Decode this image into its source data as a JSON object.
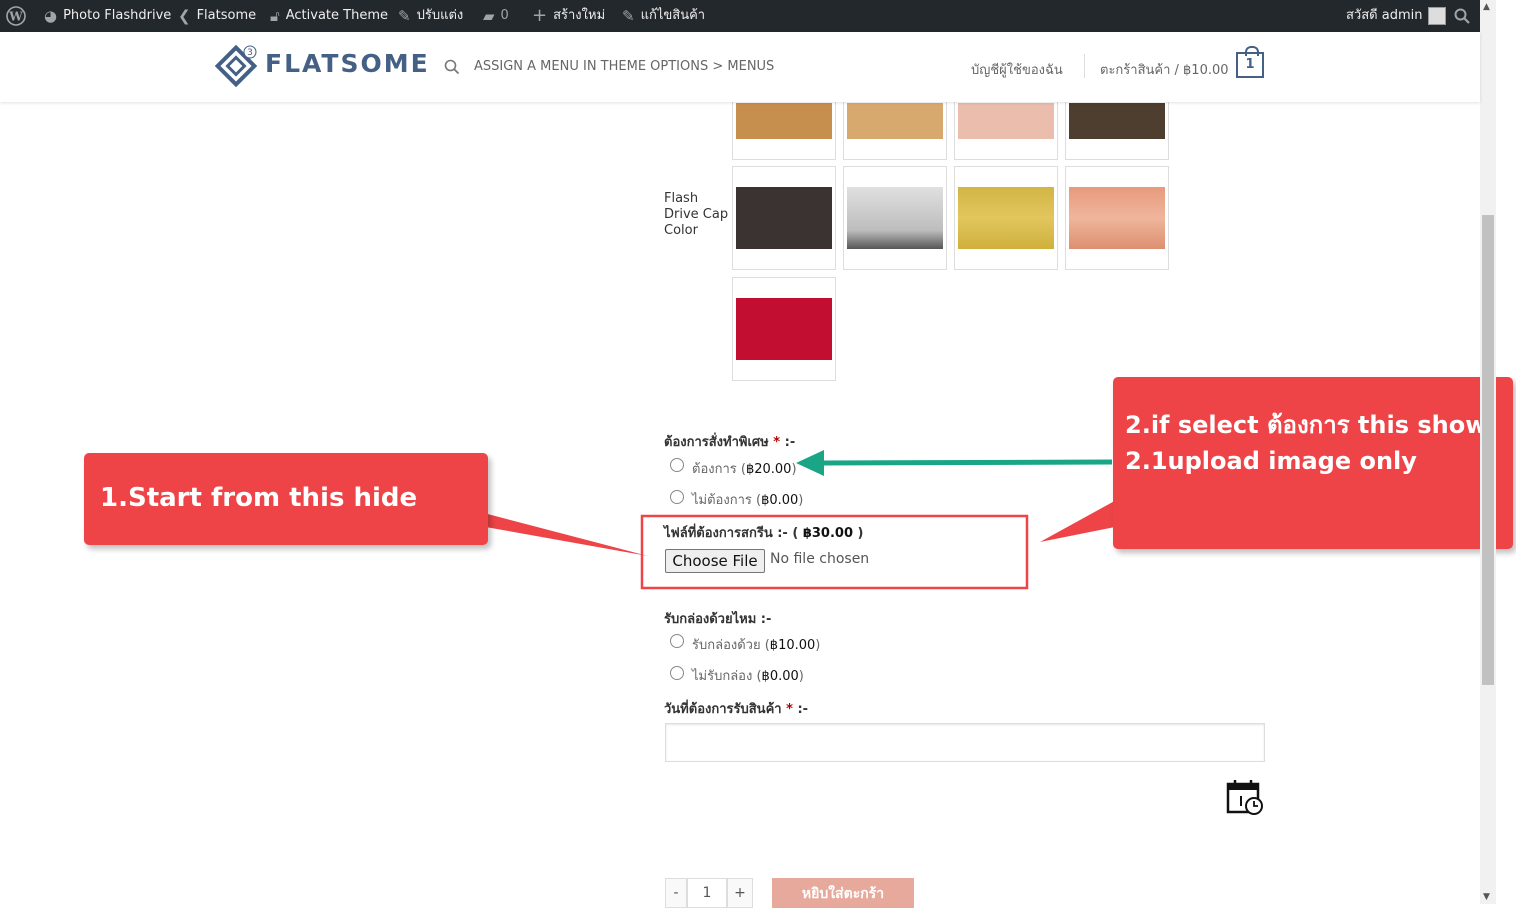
{
  "admin_bar": {
    "site_name": "Photo Flashdrive",
    "theme": "Flatsome",
    "activate": "Activate Theme",
    "customize": "ปรับแต่ง",
    "comments_count": "0",
    "new": "สร้างใหม่",
    "edit_product": "แก้ไขสินค้า",
    "greeting": "สวัสดี admin"
  },
  "header": {
    "logo_text": "FLATSOME",
    "logo_badge": "3",
    "menu_hint": "ASSIGN A MENU IN THEME OPTIONS > MENUS",
    "account": "บัญชีผู้ใช้ของฉัน",
    "cart_label": "ตะกร้าสินค้า / ฿10.00",
    "cart_count": "1"
  },
  "swatches_top": [
    "#c78f4e",
    "#d8a96f",
    "#eabdac",
    "#4e3e30"
  ],
  "cap_color": {
    "label": "Flash Drive Cap Color",
    "swatches": [
      "#3a3331",
      "#c9c9c9",
      "#d7ba47",
      "#e39f82",
      "#c20f31"
    ]
  },
  "special_order": {
    "label": "ต้องการสั่งทำพิเศษ",
    "required": "*",
    "suffix": ":-",
    "opt_yes": "ต้องการ (",
    "opt_yes_price": "฿20.00",
    "opt_no": "ไม่ต้องการ (",
    "opt_no_price": "฿0.00"
  },
  "file_upload": {
    "label": "ไฟล์ที่ต้องการสกรีน :- (",
    "price": "฿30.00",
    "button": "Choose File",
    "status": "No file chosen"
  },
  "gift_box": {
    "label": "รับกล่องด้วยไหม :-",
    "opt_yes": "รับกล่องด้วย (",
    "opt_yes_price": "฿10.00",
    "opt_no": "ไม่รับกล่อง (",
    "opt_no_price": "฿0.00"
  },
  "date_field": {
    "label": "วันที่ต้องการรับสินค้า",
    "required": "*",
    "suffix": ":-",
    "value": ""
  },
  "cart_controls": {
    "minus": "-",
    "qty": "1",
    "plus": "+",
    "add_to_cart": "หยิบใส่ตะกร้า"
  },
  "annotations": {
    "callout1": "1.Start from this hide",
    "callout2_line1": "2.if select ต้องการ this show",
    "callout2_line2": "2.1upload image only",
    "accent_red": "#ee4447",
    "arrow_teal": "#1aa686"
  }
}
